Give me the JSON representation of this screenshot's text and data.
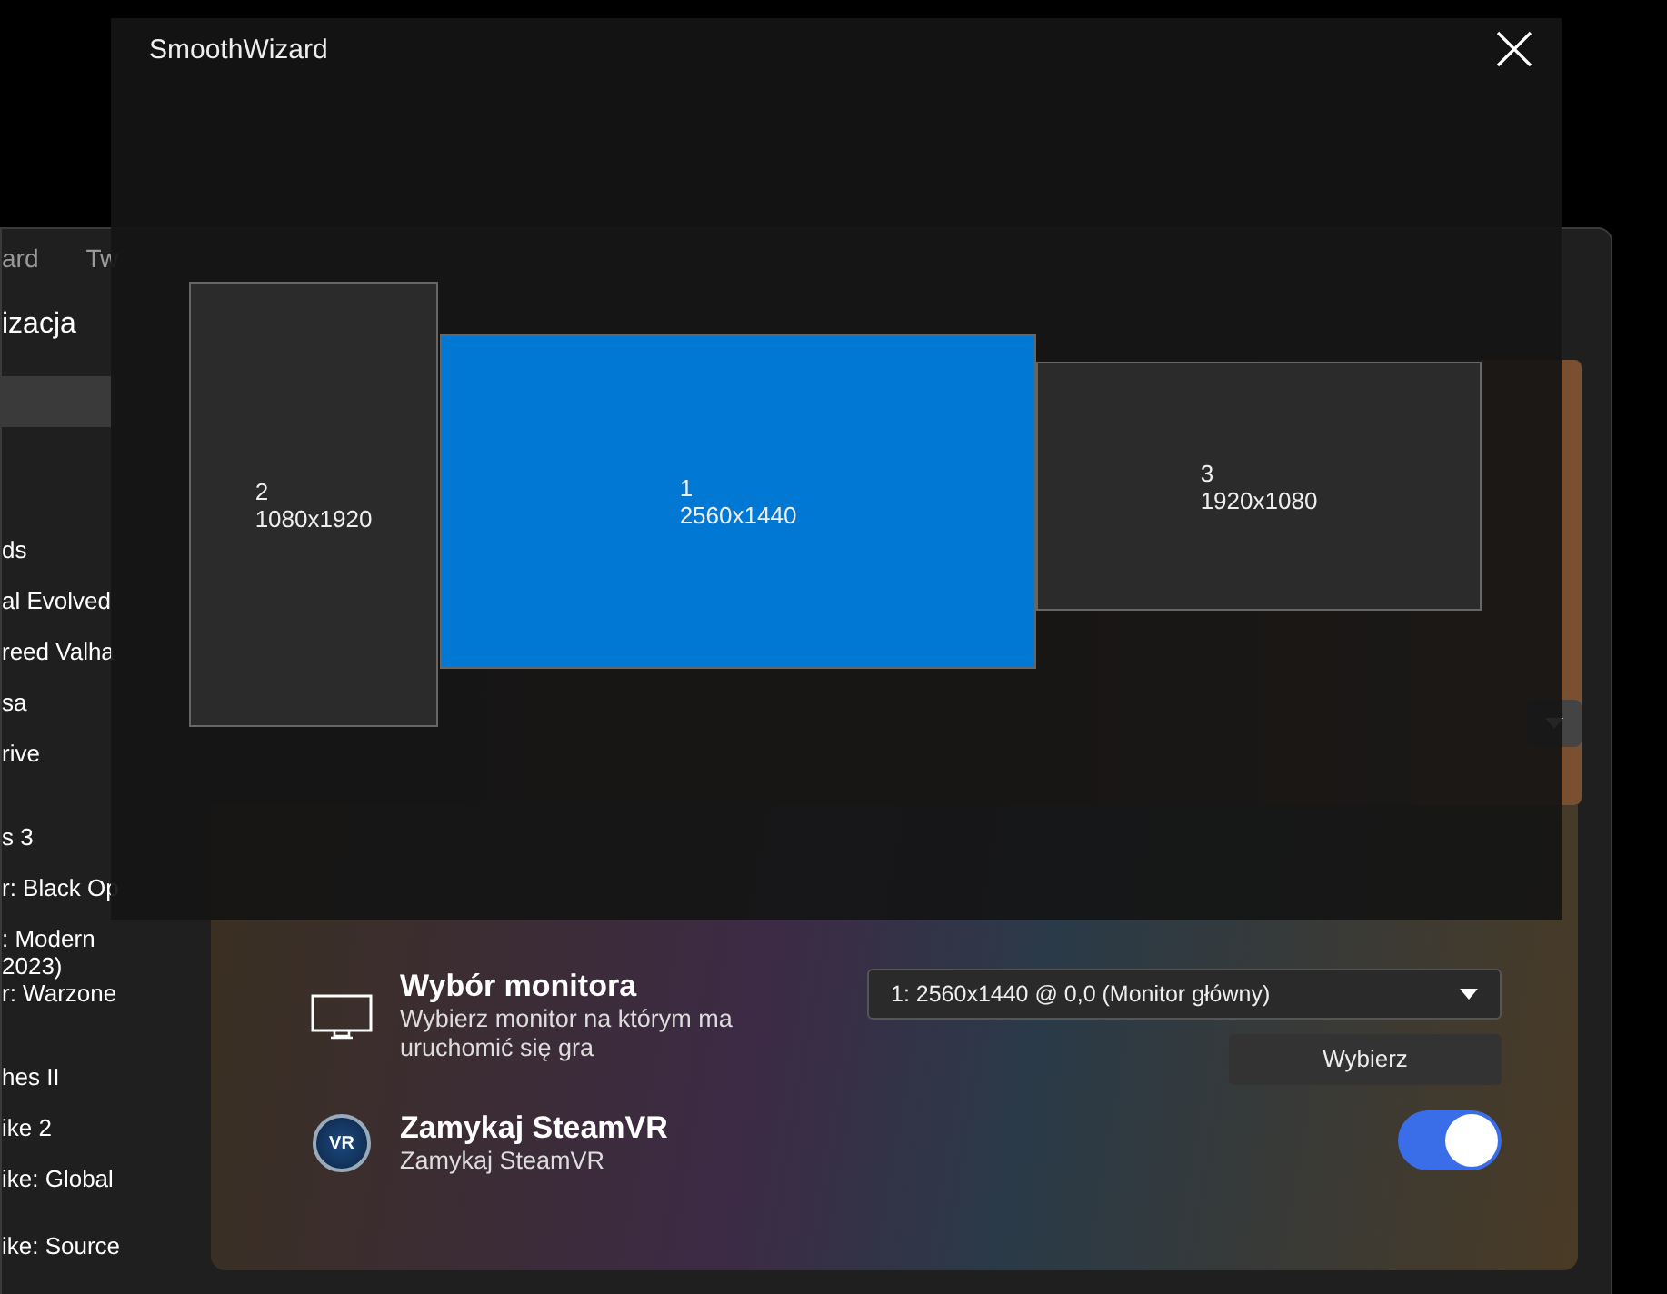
{
  "background_window": {
    "menu": [
      "ard",
      "Tw"
    ],
    "sidebar": {
      "title": "izacja",
      "items": [
        {
          "label": "ds"
        },
        {
          "label": "al Evolved"
        },
        {
          "label": "reed Valha"
        },
        {
          "label": "sa"
        },
        {
          "label": "rive"
        },
        {
          "label": "s 3"
        },
        {
          "label": "r: Black Op"
        },
        {
          "label": ": Modern\n2023)"
        },
        {
          "label": "r: Warzone"
        },
        {
          "label": "hes II"
        },
        {
          "label": "ike 2"
        },
        {
          "label": "ike: Global"
        },
        {
          "label": "ike: Source"
        }
      ]
    },
    "launch_options": {
      "rows": [
        {
          "kind": "select",
          "title": "Wybór monitora",
          "description": "Wybierz monitor na którym ma uruchomić się gra",
          "value": "1: 2560x1440 @ 0,0 (Monitor główny)",
          "button": "Wybierz"
        },
        {
          "kind": "toggle",
          "icon_text": "VR",
          "title": "Zamykaj SteamVR",
          "description": "Zamykaj SteamVR",
          "on": true
        }
      ]
    }
  },
  "dialog": {
    "title": "SmoothWizard",
    "monitors": [
      {
        "number": "2",
        "resolution": "1080x1920",
        "selected": false
      },
      {
        "number": "1",
        "resolution": "2560x1440",
        "selected": true
      },
      {
        "number": "3",
        "resolution": "1920x1080",
        "selected": false
      }
    ]
  }
}
